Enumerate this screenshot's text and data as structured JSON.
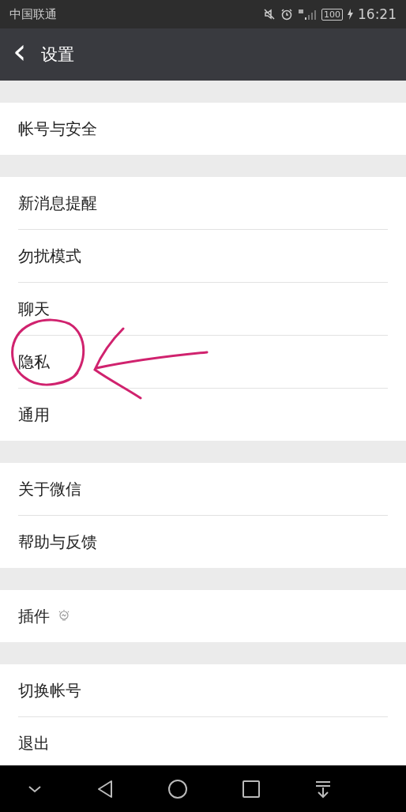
{
  "status_bar": {
    "carrier": "中国联通",
    "battery": "100",
    "time": "16:21"
  },
  "header": {
    "back": "‹",
    "title": "设置"
  },
  "groups": [
    {
      "items": [
        {
          "label": "帐号与安全",
          "kind": "plain"
        }
      ]
    },
    {
      "items": [
        {
          "label": "新消息提醒",
          "kind": "plain"
        },
        {
          "label": "勿扰模式",
          "kind": "plain"
        },
        {
          "label": "聊天",
          "kind": "plain"
        },
        {
          "label": "隐私",
          "kind": "plain"
        },
        {
          "label": "通用",
          "kind": "plain"
        }
      ]
    },
    {
      "items": [
        {
          "label": "关于微信",
          "kind": "plain"
        },
        {
          "label": "帮助与反馈",
          "kind": "plain"
        }
      ]
    },
    {
      "items": [
        {
          "label": "插件",
          "kind": "with_icon"
        }
      ]
    },
    {
      "items": [
        {
          "label": "切换帐号",
          "kind": "plain"
        },
        {
          "label": "退出",
          "kind": "plain"
        }
      ]
    }
  ],
  "annotation": {
    "color": "#d0226e"
  }
}
